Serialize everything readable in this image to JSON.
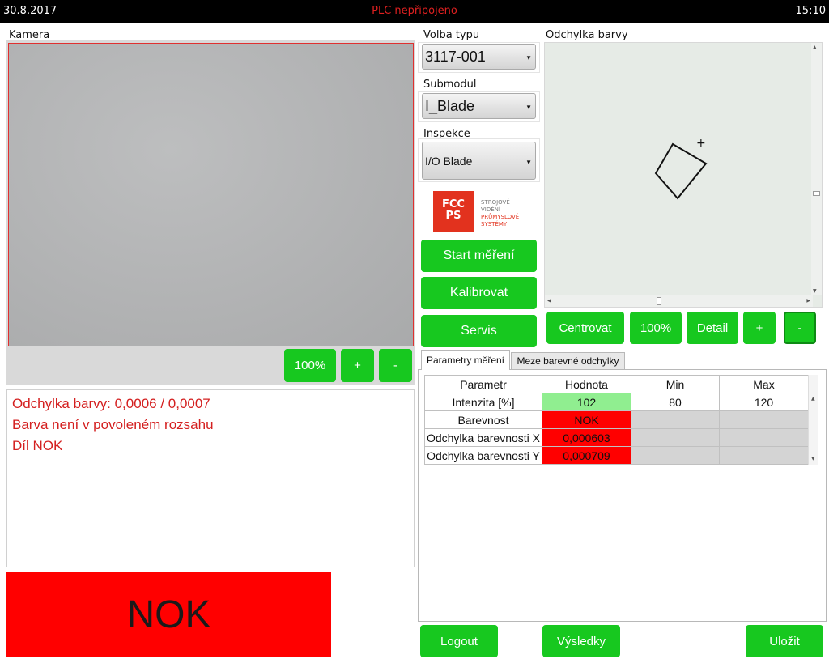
{
  "topbar": {
    "date": "30.8.2017",
    "plc_status": "PLC nepřipojeno",
    "time": "15:10"
  },
  "camera": {
    "label": "Kamera",
    "zoom_100": "100%",
    "zoom_in": "+",
    "zoom_out": "-"
  },
  "messages": [
    "Odchylka barvy: 0,0006 / 0,0007",
    "Barva není v povoleném rozsahu",
    "Díl NOK"
  ],
  "result": {
    "text": "NOK",
    "color": "#ff0000"
  },
  "type_select": {
    "label": "Volba typu",
    "value": "3117-001"
  },
  "submodule_select": {
    "label": "Submodul",
    "value": "I_Blade"
  },
  "inspection_select": {
    "label": "Inspekce",
    "value": "I/O Blade"
  },
  "logo": {
    "mark_line1": "FCC",
    "mark_line2": "PS",
    "text_line1": "STROJOVÉ",
    "text_line2": "VIDĚNÍ",
    "text_line3": "PRŮMYSLOVÉ",
    "text_line4": "SYSTÉMY"
  },
  "actions": {
    "start": "Start měření",
    "calibrate": "Kalibrovat",
    "service": "Servis"
  },
  "color_deviation": {
    "label": "Odchylka barvy",
    "center": "Centrovat",
    "zoom_100": "100%",
    "detail": "Detail",
    "zoom_in": "+",
    "zoom_out": "-",
    "marker": "+"
  },
  "tabs": [
    {
      "label": "Parametry měření",
      "active": true
    },
    {
      "label": "Meze barevné odchylky",
      "active": false
    }
  ],
  "params_table": {
    "headers": [
      "Parametr",
      "Hodnota",
      "Min",
      "Max"
    ],
    "rows": [
      {
        "param": "Intenzita [%]",
        "value": "102",
        "min": "80",
        "max": "120",
        "status_color": "#90ee90"
      },
      {
        "param": "Barevnost",
        "value": "NOK",
        "min": "",
        "max": "",
        "status_color": "#ff0000"
      },
      {
        "param": "Odchylka barevnosti X",
        "value": "0,000603",
        "min": "",
        "max": "",
        "status_color": "#ff0000"
      },
      {
        "param": "Odchylka barevnosti Y",
        "value": "0,000709",
        "min": "",
        "max": "",
        "status_color": "#ff0000"
      }
    ]
  },
  "footer": {
    "logout": "Logout",
    "results": "Výsledky",
    "save": "Uložit"
  },
  "accent_color": "#17c81f"
}
